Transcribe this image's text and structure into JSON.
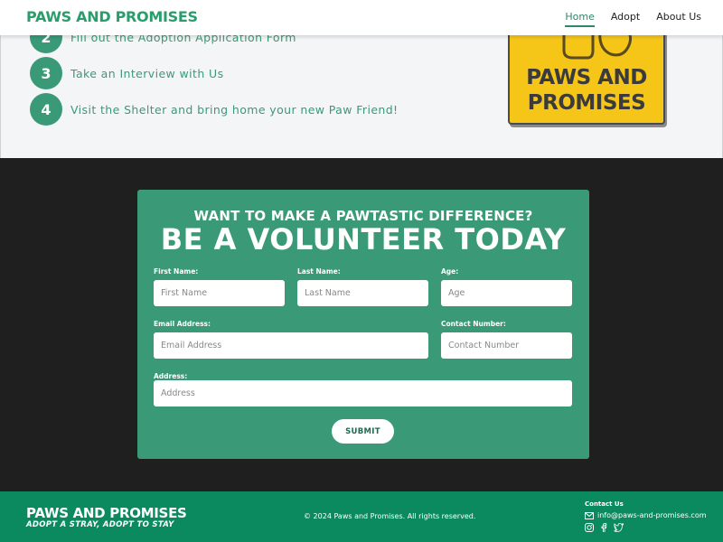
{
  "nav": {
    "brand": "PAWS AND PROMISES",
    "links": [
      {
        "label": "Home",
        "active": true
      },
      {
        "label": "Adopt",
        "active": false
      },
      {
        "label": "About Us",
        "active": false
      }
    ]
  },
  "steps": [
    {
      "number": "2",
      "text": "Fill out the Adoption Application Form"
    },
    {
      "number": "3",
      "text": "Take an Interview with Us"
    },
    {
      "number": "4",
      "text": "Visit the Shelter and bring home your new Paw Friend!"
    }
  ],
  "logo_card": {
    "line1": "PAWS AND",
    "line2": "PROMISES"
  },
  "volunteer": {
    "subtitle": "WANT TO MAKE A PAWTASTIC DIFFERENCE?",
    "title": "BE A VOLUNTEER TODAY",
    "fields": {
      "first_name": {
        "label": "First Name:",
        "placeholder": "First Name"
      },
      "last_name": {
        "label": "Last Name:",
        "placeholder": "Last Name"
      },
      "age": {
        "label": "Age:",
        "placeholder": "Age"
      },
      "email": {
        "label": "Email Address:",
        "placeholder": "Email Address"
      },
      "contact": {
        "label": "Contact Number:",
        "placeholder": "Contact Number"
      },
      "address": {
        "label": "Address:",
        "placeholder": "Address"
      }
    },
    "submit_label": "SUBMIT"
  },
  "footer": {
    "brand": "PAWS AND PROMISES",
    "tagline": "ADOPT A STRAY, ADOPT TO STAY",
    "copyright": "© 2024 Paws and Promises. All rights reserved.",
    "contact_title": "Contact Us",
    "email": "info@paws-and-promises.com",
    "socials": [
      "instagram-icon",
      "facebook-icon",
      "twitter-icon"
    ]
  },
  "colors": {
    "primary_green": "#3a9a78",
    "footer_green": "#0a8a5e",
    "brand_green": "#2a9d6c",
    "logo_yellow": "#f5c518",
    "dark_bg": "#1f1f1f"
  }
}
